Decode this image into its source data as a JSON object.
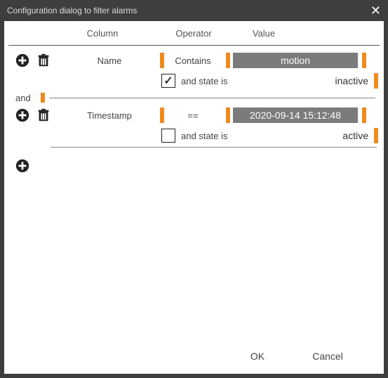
{
  "title": "Configuration dialog to filter alarms",
  "columns": {
    "c1": "Column",
    "c2": "Operator",
    "c3": "Value"
  },
  "rules": [
    {
      "column": "Name",
      "operator": "Contains",
      "value": "motion",
      "state_label": "and state is",
      "state_checked": true,
      "state_value": "inactive"
    },
    {
      "column": "Timestamp",
      "operator": "==",
      "value": "2020-09-14 15:12:48",
      "state_label": "and state is",
      "state_checked": false,
      "state_value": "active"
    }
  ],
  "connector": "and",
  "footer": {
    "ok": "OK",
    "cancel": "Cancel"
  },
  "colors": {
    "accent": "#f08a1d",
    "value_bg": "#7b7b7b"
  }
}
